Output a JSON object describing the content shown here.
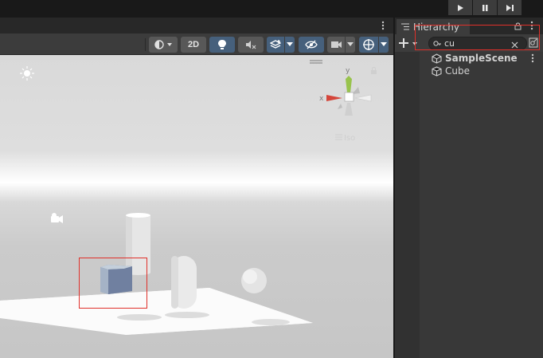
{
  "playbar": {
    "play": "play-icon",
    "pause": "pause-icon",
    "step": "step-icon"
  },
  "scene_toolbar": {
    "toggle_2d_label": "2D",
    "buttons": [
      "shading-mode-icon",
      "lighting-icon",
      "audio-icon",
      "effects-icon",
      "hidden-objects-icon",
      "camera-icon",
      "gizmos-icon"
    ]
  },
  "scene_view": {
    "gizmo_axis_y": "y",
    "gizmo_axis_x": "x",
    "projection_label": "Iso"
  },
  "hierarchy": {
    "tab_title": "Hierarchy",
    "search_value": "cu",
    "items": [
      {
        "label": "SampleScene",
        "icon": "unity-scene-icon"
      },
      {
        "label": "Cube",
        "icon": "cube-icon"
      }
    ]
  },
  "colors": {
    "accent_active": "#46607c",
    "highlight_box": "#e0302a",
    "panel_bg": "#383838"
  }
}
